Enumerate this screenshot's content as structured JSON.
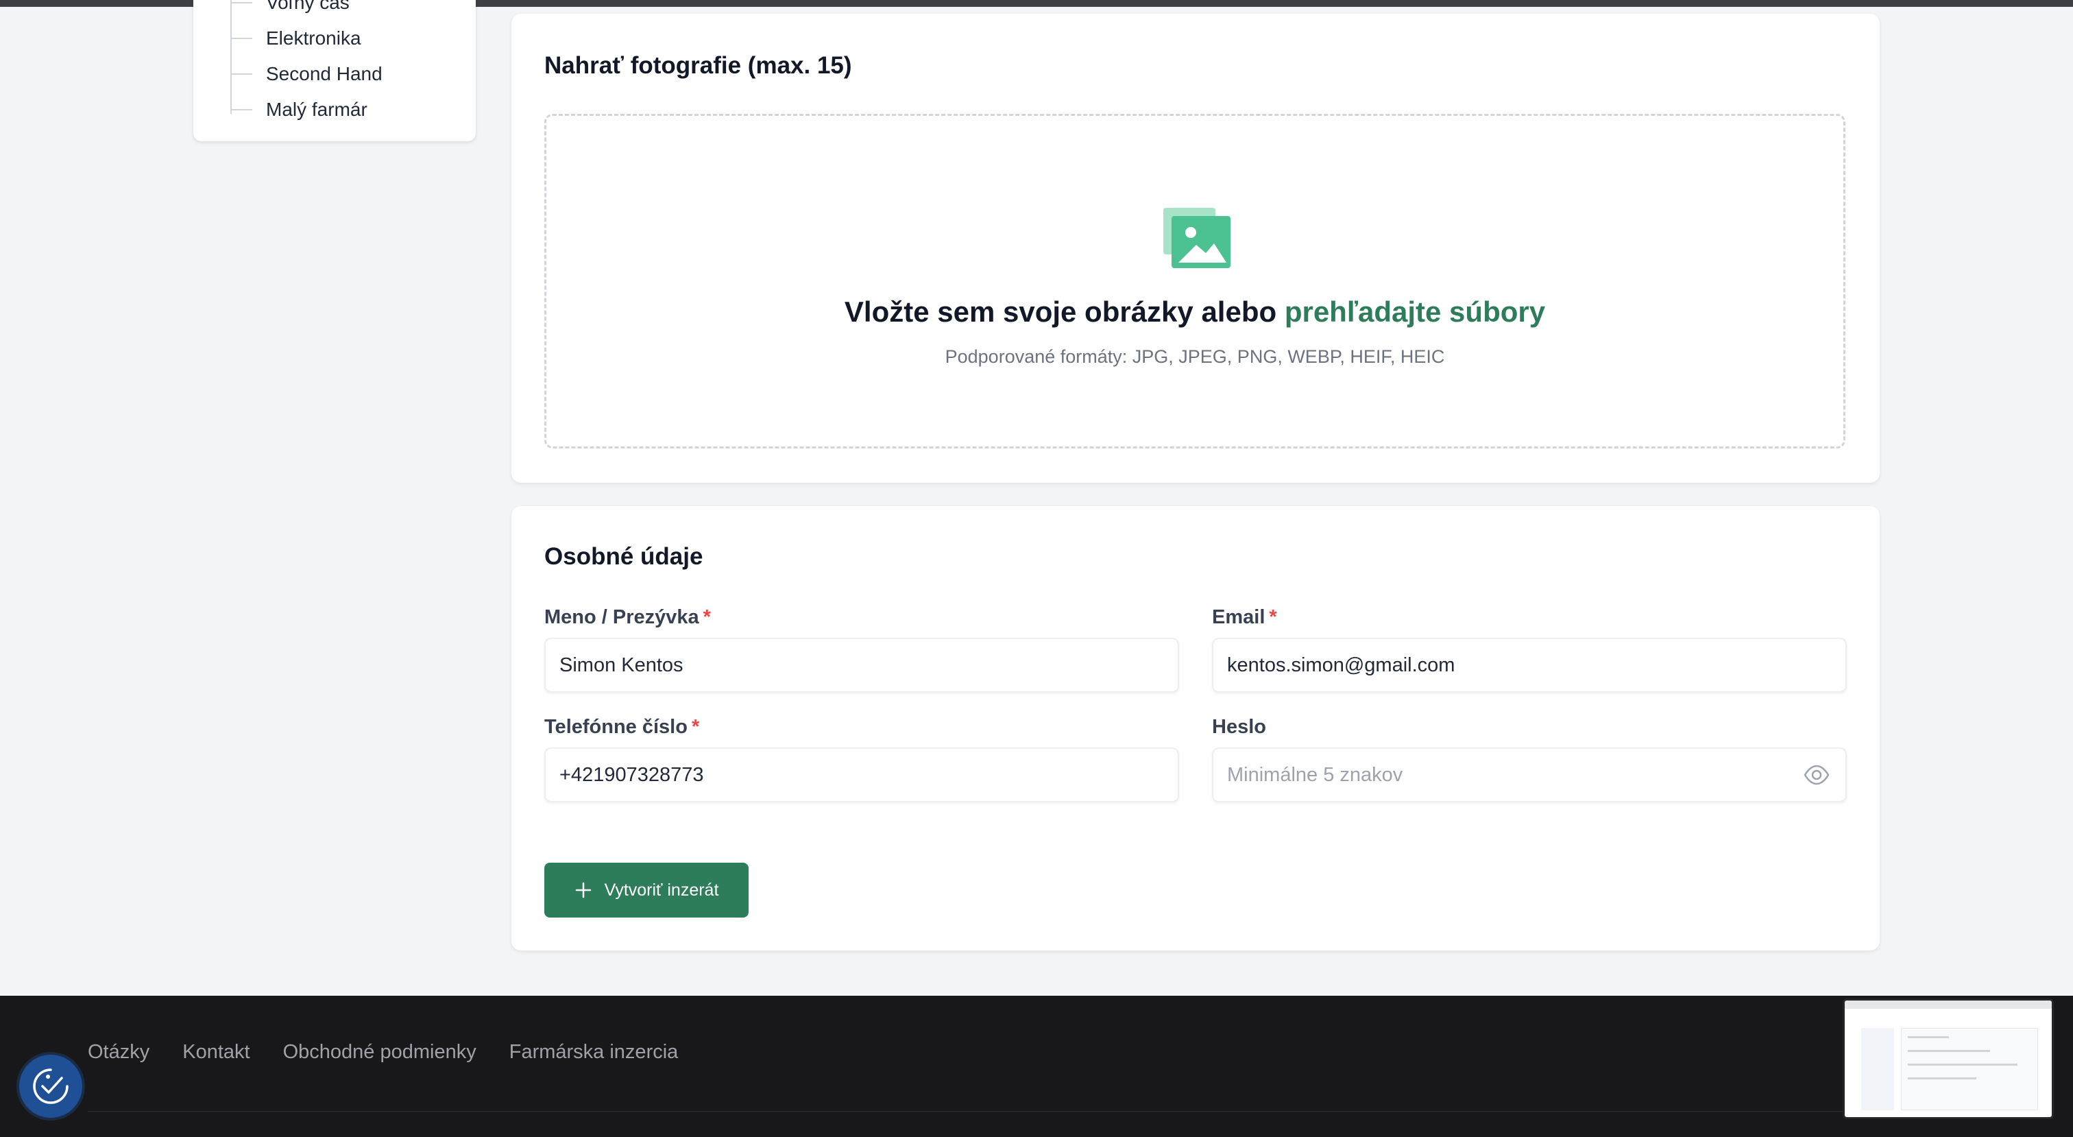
{
  "categories": {
    "items": [
      {
        "label": "Voľný čas"
      },
      {
        "label": "Elektronika"
      },
      {
        "label": "Second Hand"
      },
      {
        "label": "Malý farmár"
      }
    ]
  },
  "photos": {
    "title": "Nahrať fotografie (max. 15)",
    "drop_text": "Vložte sem svoje obrázky alebo",
    "browse_link": "prehľadajte súbory",
    "formats": "Podporované formáty: JPG, JPEG, PNG, WEBP, HEIF, HEIC"
  },
  "personal": {
    "title": "Osobné údaje",
    "required_mark": "*",
    "name_label": "Meno / Prezývka",
    "name_value": "Simon Kentos",
    "email_label": "Email",
    "email_value": "kentos.simon@gmail.com",
    "phone_label": "Telefónne číslo",
    "phone_value": "+421907328773",
    "password_label": "Heslo",
    "password_placeholder": "Minimálne 5 znakov",
    "submit_label": "Vytvoriť inzerát"
  },
  "footer": {
    "links": [
      "Otázky",
      "Kontakt",
      "Obchodné podmienky",
      "Farmárska inzercia"
    ]
  },
  "colors": {
    "accent": "#2e7d5a",
    "footer_bg": "#18181b",
    "required": "#ef4444",
    "a11y_button": "#1f4f95"
  },
  "icons": {
    "dropzone": "image-gallery-icon",
    "password_toggle": "eye-icon",
    "submit": "plus-icon",
    "accessibility": "accessibility-check-icon"
  }
}
